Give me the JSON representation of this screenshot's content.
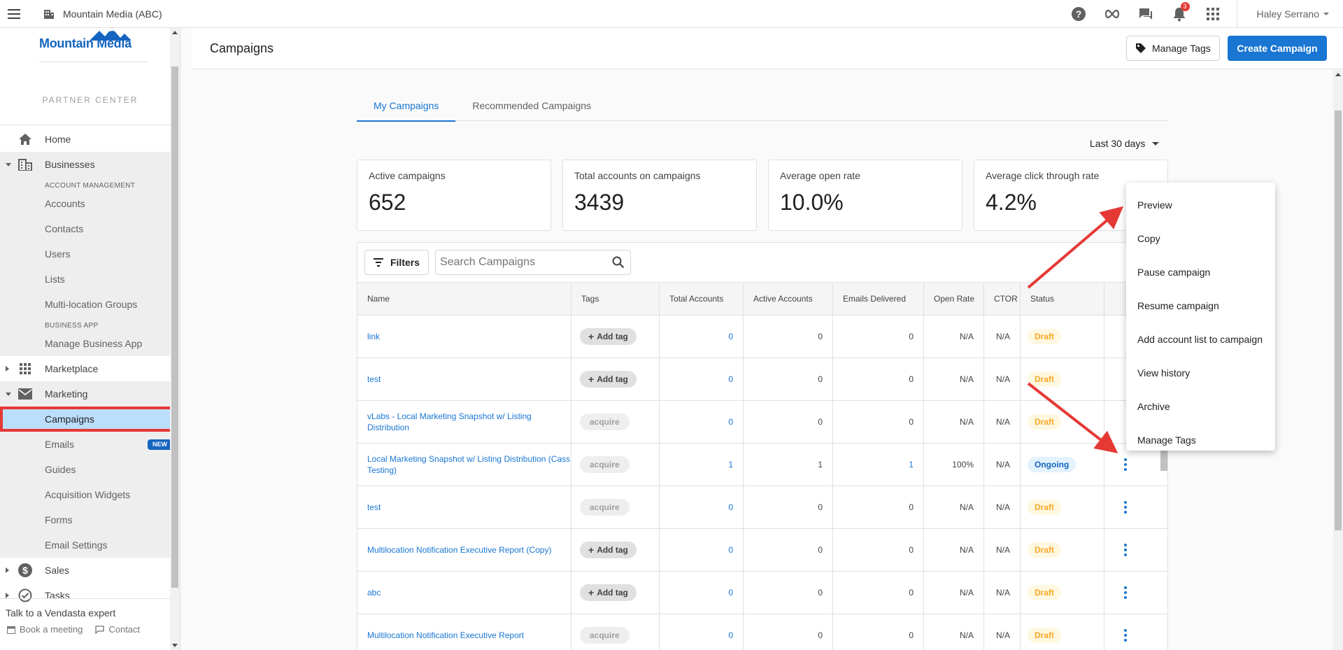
{
  "topbar": {
    "org_name": "Mountain Media (ABC)",
    "notification_count": "3",
    "user_name": "Haley Serrano"
  },
  "sidebar": {
    "brand": "Mountain Media",
    "partner_center": "PARTNER CENTER",
    "home": "Home",
    "businesses": "Businesses",
    "account_mgmt_head": "ACCOUNT MANAGEMENT",
    "account_items": [
      "Accounts",
      "Contacts",
      "Users",
      "Lists",
      "Multi-location Groups"
    ],
    "business_app_head": "BUSINESS APP",
    "business_app_items": [
      "Manage Business App"
    ],
    "marketplace": "Marketplace",
    "marketing": "Marketing",
    "marketing_items": [
      "Campaigns",
      "Emails",
      "Guides",
      "Acquisition Widgets",
      "Forms",
      "Email Settings"
    ],
    "new_badge": "NEW",
    "sales": "Sales",
    "tasks": "Tasks",
    "expert_title": "Talk to a Vendasta expert",
    "book_meeting": "Book a meeting",
    "contact": "Contact"
  },
  "header": {
    "title": "Campaigns",
    "manage_tags": "Manage Tags",
    "create_campaign": "Create Campaign"
  },
  "tabs": [
    "My Campaigns",
    "Recommended Campaigns"
  ],
  "range": "Last 30 days",
  "stats": [
    {
      "label": "Active campaigns",
      "value": "652"
    },
    {
      "label": "Total accounts on campaigns",
      "value": "3439"
    },
    {
      "label": "Average open rate",
      "value": "10.0%"
    },
    {
      "label": "Average click through rate",
      "value": "4.2%"
    }
  ],
  "toolbar": {
    "filters": "Filters",
    "search_placeholder": "Search Campaigns"
  },
  "table": {
    "columns": [
      "Name",
      "Tags",
      "Total Accounts",
      "Active Accounts",
      "Emails Delivered",
      "Open Rate",
      "CTOR",
      "Status"
    ],
    "rows": [
      {
        "name": "link",
        "tag": "Add tag",
        "tag_type": "add",
        "total": "0",
        "active": "0",
        "emails": "0",
        "open": "N/A",
        "ctor": "N/A",
        "status": "Draft"
      },
      {
        "name": "test",
        "tag": "Add tag",
        "tag_type": "add",
        "total": "0",
        "active": "0",
        "emails": "0",
        "open": "N/A",
        "ctor": "N/A",
        "status": "Draft"
      },
      {
        "name": "vLabs - Local Marketing Snapshot w/ Listing Distribution",
        "tag": "acquire",
        "tag_type": "plain",
        "total": "0",
        "active": "0",
        "emails": "0",
        "open": "N/A",
        "ctor": "N/A",
        "status": "Draft"
      },
      {
        "name": "Local Marketing Snapshot w/ Listing Distribution (Cass Testing)",
        "tag": "acquire",
        "tag_type": "plain",
        "total": "1",
        "active": "1",
        "emails": "1",
        "open": "100%",
        "ctor": "N/A",
        "status": "Ongoing"
      },
      {
        "name": "test",
        "tag": "acquire",
        "tag_type": "plain",
        "total": "0",
        "active": "0",
        "emails": "0",
        "open": "N/A",
        "ctor": "N/A",
        "status": "Draft"
      },
      {
        "name": "Multilocation Notification Executive Report (Copy)",
        "tag": "Add tag",
        "tag_type": "add",
        "total": "0",
        "active": "0",
        "emails": "0",
        "open": "N/A",
        "ctor": "N/A",
        "status": "Draft"
      },
      {
        "name": "abc",
        "tag": "Add tag",
        "tag_type": "add",
        "total": "0",
        "active": "0",
        "emails": "0",
        "open": "N/A",
        "ctor": "N/A",
        "status": "Draft"
      },
      {
        "name": "Multilocation Notification Executive Report",
        "tag": "acquire",
        "tag_type": "plain",
        "total": "0",
        "active": "0",
        "emails": "0",
        "open": "N/A",
        "ctor": "N/A",
        "status": "Draft"
      }
    ]
  },
  "menu": [
    "Preview",
    "Copy",
    "Pause campaign",
    "Resume campaign",
    "Add account list to campaign",
    "View history",
    "Archive",
    "Manage Tags"
  ],
  "colors": {
    "primary": "#1976d2",
    "annotation_red": "#e53935",
    "draft": "#f9a825"
  }
}
